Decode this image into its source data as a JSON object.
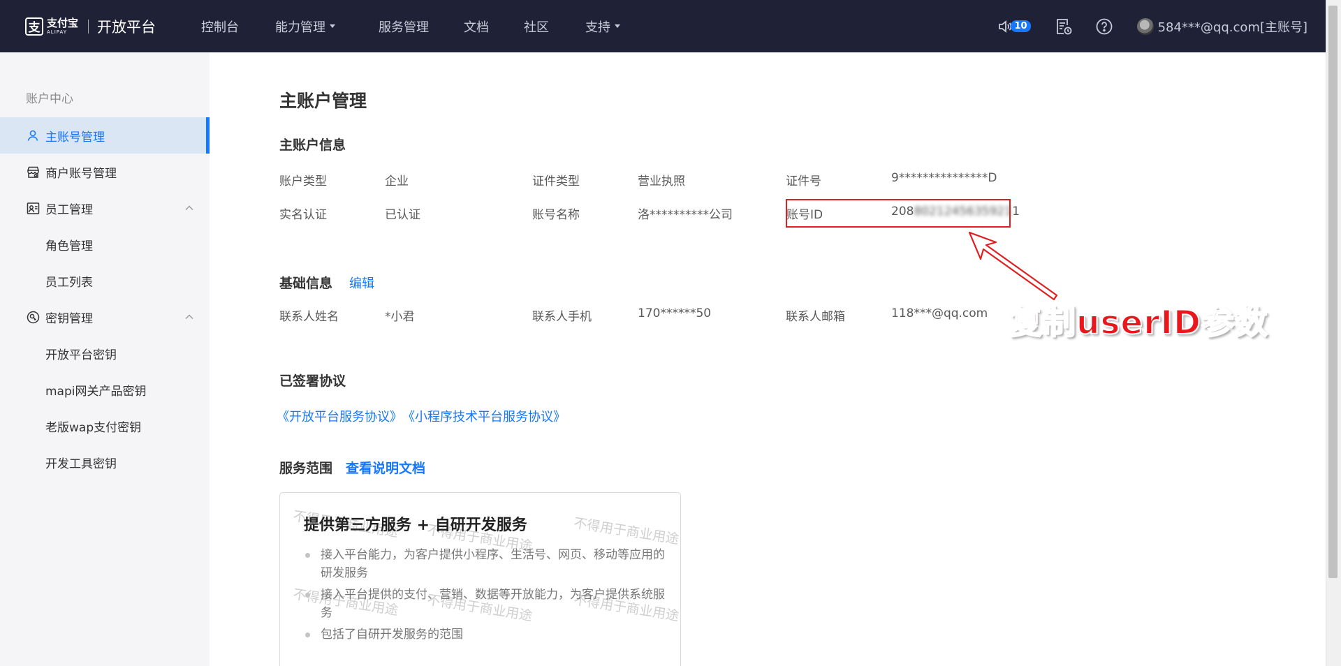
{
  "topbar": {
    "brand_mark": "支",
    "brand_cn": "支付宝",
    "brand_en": "ALIPAY",
    "platform": "开放平台",
    "nav": [
      {
        "label": "控制台",
        "dropdown": false
      },
      {
        "label": "能力管理",
        "dropdown": true
      },
      {
        "label": "服务管理",
        "dropdown": false
      },
      {
        "label": "文档",
        "dropdown": false
      },
      {
        "label": "社区",
        "dropdown": false
      },
      {
        "label": "支持",
        "dropdown": true
      }
    ],
    "notification_count": "10",
    "icons": [
      "speaker-icon",
      "document-clock-icon",
      "help-icon"
    ],
    "user": "584***@qq.com[主账号]"
  },
  "sidebar": {
    "section": "账户中心",
    "items": [
      {
        "label": "主账号管理",
        "icon": "user-icon",
        "active": true
      },
      {
        "label": "商户账号管理",
        "icon": "shop-icon"
      },
      {
        "label": "员工管理",
        "icon": "staff-icon",
        "expanded": true
      },
      {
        "label": "角色管理"
      },
      {
        "label": "员工列表"
      },
      {
        "label": "密钥管理",
        "icon": "key-icon",
        "expanded": true
      },
      {
        "label": "开放平台密钥"
      },
      {
        "label": "mapi网关产品密钥"
      },
      {
        "label": "老版wap支付密钥"
      },
      {
        "label": "开发工具密钥"
      }
    ]
  },
  "main": {
    "page_title": "主账户管理",
    "account_info": {
      "title": "主账户信息",
      "rows": [
        [
          {
            "label": "账户类型",
            "value": "企业"
          },
          {
            "label": "证件类型",
            "value": "营业执照"
          },
          {
            "label": "证件号",
            "value": "9***************D"
          }
        ],
        [
          {
            "label": "实名认证",
            "value": "已认证"
          },
          {
            "label": "账号名称",
            "value": "洛**********公司"
          },
          {
            "label": "账号ID",
            "value_start": "208",
            "value_masked": "8021245635921",
            "value_end": "1"
          }
        ]
      ]
    },
    "basic_info": {
      "title": "基础信息",
      "edit": "编辑",
      "fields": [
        {
          "label": "联系人姓名",
          "value": "*小君"
        },
        {
          "label": "联系人手机",
          "value": "170******50"
        },
        {
          "label": "联系人邮箱",
          "value": "118***@qq.com"
        }
      ]
    },
    "agreements": {
      "title": "已签署协议",
      "links": [
        "《开放平台服务协议》",
        "《小程序技术平台服务协议》"
      ]
    },
    "service_scope": {
      "title": "服务范围",
      "doc_link": "查看说明文档",
      "card_title": "提供第三方服务 + 自研开发服务",
      "bullets": [
        "接入平台能力，为客户提供小程序、生活号、网页、移动等应用的研发服务",
        "接入平台提供的支付、营销、数据等开放能力，为客户提供系统服务",
        "包括了自研开发服务的范围"
      ],
      "watermark": "不得用于商业用途"
    },
    "annotation": "复制userID参数"
  },
  "colors": {
    "topbar_bg": "#1f2237",
    "accent": "#1677ff",
    "annotation_red": "#e8181d"
  }
}
